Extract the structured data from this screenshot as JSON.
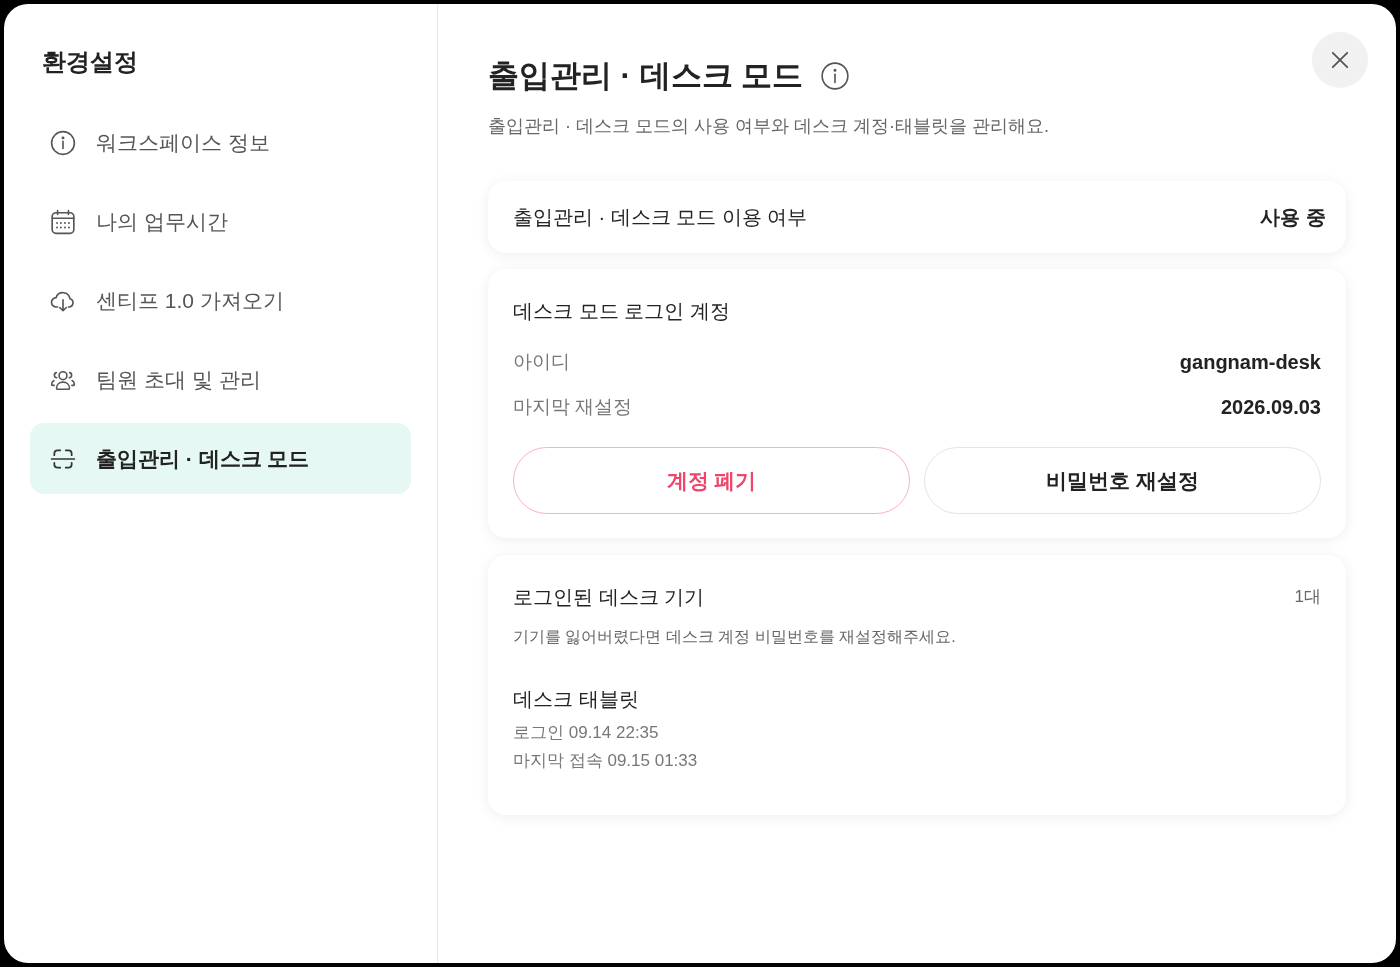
{
  "sidebar": {
    "title": "환경설정",
    "items": [
      {
        "label": "워크스페이스 정보",
        "selected": false
      },
      {
        "label": "나의 업무시간",
        "selected": false
      },
      {
        "label": "센티프 1.0 가져오기",
        "selected": false
      },
      {
        "label": "팀원 초대 및 관리",
        "selected": false
      },
      {
        "label": "출입관리 · 데스크 모드",
        "selected": true
      }
    ]
  },
  "main": {
    "title": "출입관리 · 데스크 모드",
    "description": "출입관리 · 데스크 모드의 사용 여부와 데스크 계정·태블릿을 관리해요."
  },
  "usage_card": {
    "label": "출입관리 · 데스크 모드 이용 여부",
    "value": "사용 중"
  },
  "account_card": {
    "title": "데스크 모드 로그인 계정",
    "fields": [
      {
        "label": "아이디",
        "value": "gangnam-desk"
      },
      {
        "label": "마지막 재설정",
        "value": "2026.09.03"
      }
    ],
    "buttons": [
      {
        "label": "계정 폐기",
        "kind": "danger"
      },
      {
        "label": "비밀번호 재설정",
        "kind": "default"
      }
    ]
  },
  "devices_card": {
    "title": "로그인된 데스크 기기",
    "count": "1대",
    "hint": "기기를 잃어버렸다면 데스크 계정 비밀번호를 재설정해주세요.",
    "devices": [
      {
        "name": "데스크 태블릿",
        "lines": [
          "로그인 09.14 22:35",
          "마지막 접속 09.15 01:33"
        ]
      }
    ]
  }
}
